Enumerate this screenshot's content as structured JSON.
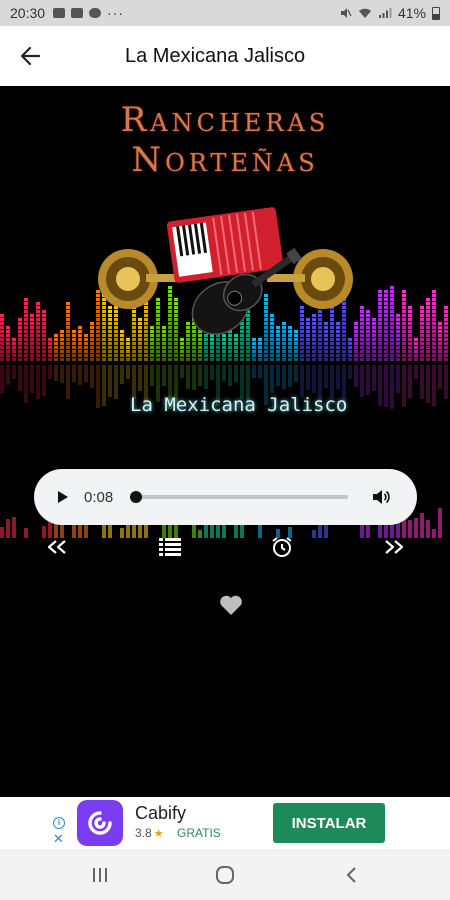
{
  "status_bar": {
    "time": "20:30",
    "battery_percent": "41%",
    "icons": [
      "image-icon",
      "youtube-icon",
      "cloud-icon",
      "more-dots-icon",
      "mute-icon",
      "wifi-icon",
      "signal-icon",
      "battery-icon"
    ]
  },
  "app_bar": {
    "title": "La Mexicana Jalisco",
    "back_icon": "arrow-left-icon"
  },
  "artwork": {
    "title_line1": "Rancheras",
    "title_line2": "Norteñas",
    "station_name": "La Mexicana Jalisco",
    "images": [
      "trumpet-icon",
      "accordion-icon",
      "guitar-icon",
      "trumpet-icon"
    ],
    "equalizer_colors": [
      "#ff2b4f",
      "#ff7a1a",
      "#ffd21a",
      "#7be31a",
      "#18d6a0",
      "#18b8ff",
      "#5b5bff",
      "#c234ff",
      "#ff34c8"
    ]
  },
  "player": {
    "elapsed": "0:08",
    "progress": 0.0,
    "play_icon": "play-icon",
    "volume_icon": "volume-icon"
  },
  "controls": {
    "icons": [
      "rewind-icon",
      "playlist-icon",
      "alarm-icon",
      "fast-forward-icon",
      "heart-icon"
    ]
  },
  "ad": {
    "app_name": "Cabify",
    "rating": "3.8",
    "price_label": "GRATIS",
    "install_label": "INSTALAR",
    "logo_color": "#7a3cf0",
    "button_color": "#1e8a5a"
  },
  "nav_bar": {
    "icons": [
      "recent-apps-icon",
      "home-icon",
      "back-icon"
    ]
  }
}
